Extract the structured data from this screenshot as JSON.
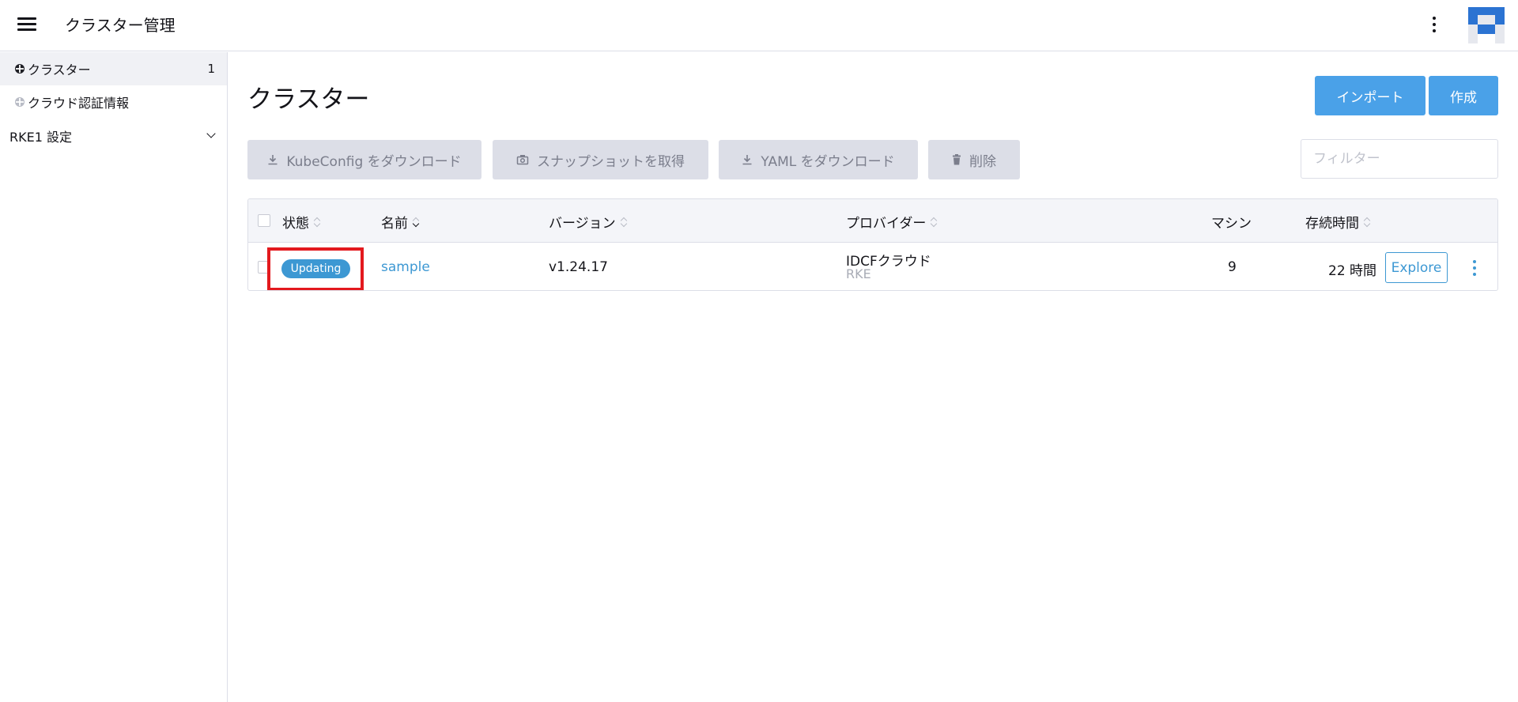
{
  "header": {
    "title": "クラスター管理"
  },
  "sidebar": {
    "items": [
      {
        "label": "クラスター",
        "count": "1"
      },
      {
        "label": "クラウド認証情報"
      }
    ],
    "group": {
      "label": "RKE1 設定"
    }
  },
  "main": {
    "title": "クラスター",
    "import_label": "インポート",
    "create_label": "作成",
    "actions": {
      "kubeconfig": "KubeConfig をダウンロード",
      "snapshot": "スナップショットを取得",
      "yaml": "YAML をダウンロード",
      "delete": "削除"
    },
    "filter_placeholder": "フィルター"
  },
  "table": {
    "headers": {
      "state": "状態",
      "name": "名前",
      "version": "バージョン",
      "provider": "プロバイダー",
      "machines": "マシン",
      "age": "存続時間"
    },
    "rows": [
      {
        "state": "Updating",
        "name": "sample",
        "version": "v1.24.17",
        "provider": "IDCFクラウド",
        "provider_sub": "RKE",
        "machines": "9",
        "age": "22 時間",
        "explore": "Explore"
      }
    ]
  },
  "colors": {
    "primary": "#4aa1e8",
    "link": "#3d98d3",
    "highlight": "#e3191e"
  }
}
